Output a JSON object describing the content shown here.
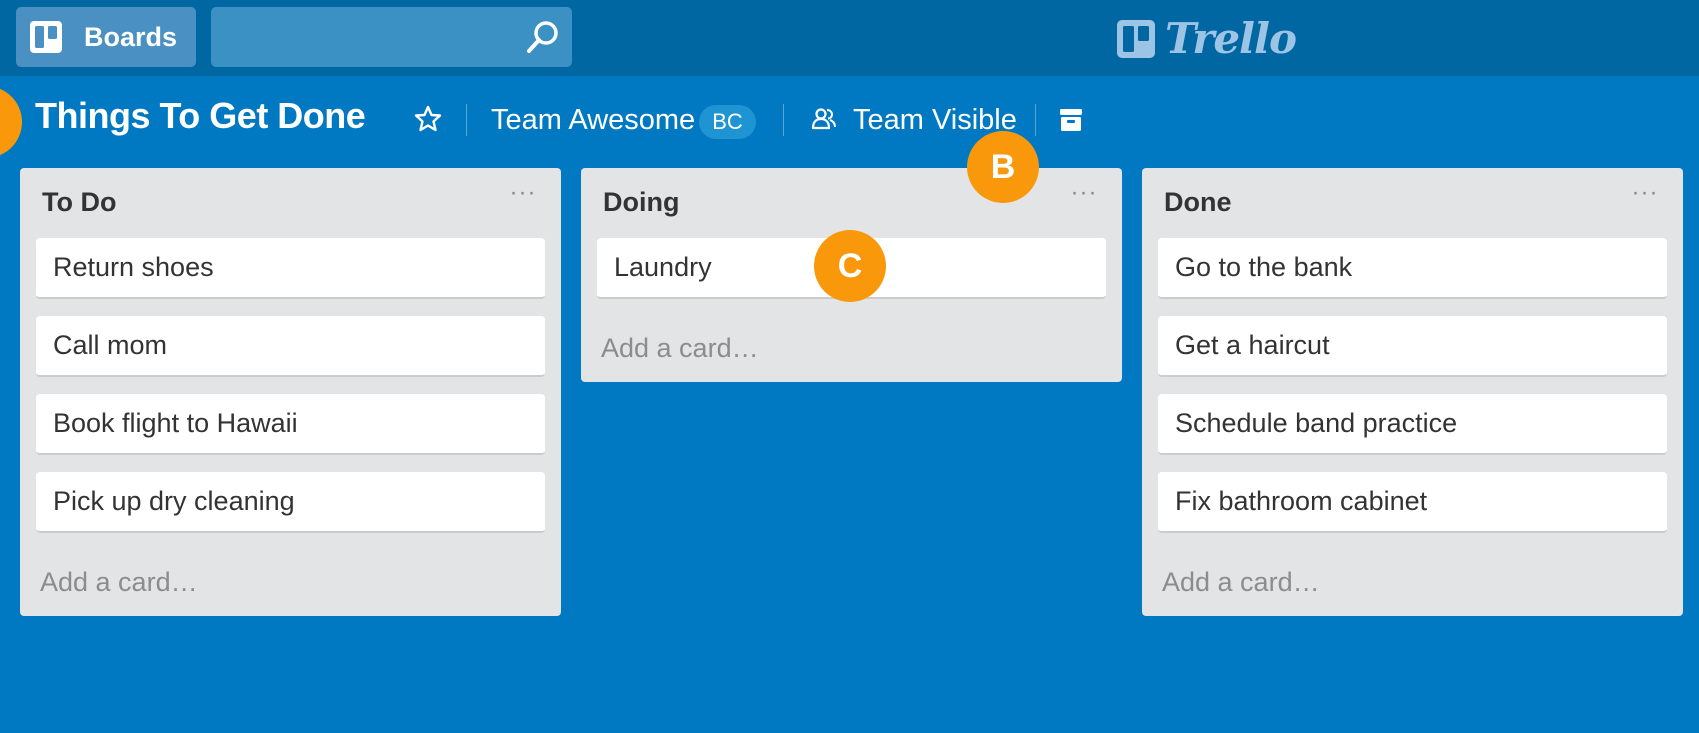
{
  "topbar": {
    "boards_label": "Boards",
    "search_value": "",
    "logo_text": "Trello"
  },
  "board": {
    "title": "Things To Get Done",
    "team_name": "Team Awesome",
    "team_badge": "BC",
    "visibility": "Team Visible"
  },
  "callouts": {
    "a": "",
    "b": "B",
    "c": "C"
  },
  "lists": [
    {
      "title": "To Do",
      "menu": "···",
      "cards": [
        "Return shoes",
        "Call mom",
        "Book flight to Hawaii",
        "Pick up dry cleaning"
      ],
      "add_card": "Add a card…"
    },
    {
      "title": "Doing",
      "menu": "···",
      "cards": [
        "Laundry"
      ],
      "add_card": "Add a card…"
    },
    {
      "title": "Done",
      "menu": "···",
      "cards": [
        "Go to the bank",
        "Get a haircut",
        "Schedule band practice",
        "Fix bathroom cabinet"
      ],
      "add_card": "Add a card…"
    }
  ],
  "icons": {
    "boards": "boards-icon",
    "search": "search-icon",
    "star": "star-icon",
    "team_visibility": "team-visibility-icon",
    "archive": "archive-icon",
    "logo": "trello-logo-icon"
  },
  "colors": {
    "background": "#0079c2",
    "topbar": "#0067a3",
    "callout": "#f8980a",
    "list": "#e2e4e6",
    "card": "#ffffff"
  }
}
